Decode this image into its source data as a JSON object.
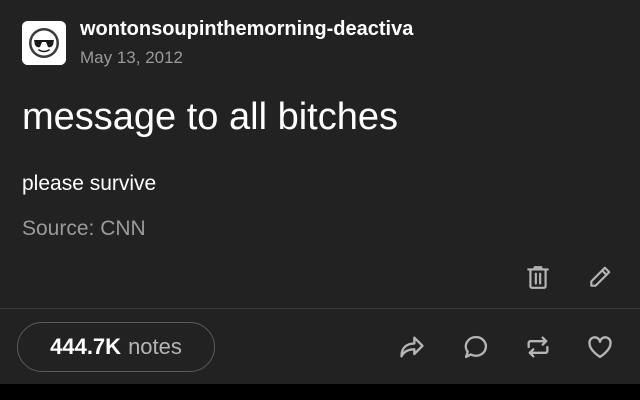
{
  "post": {
    "blog_name": "wontonsoupinthemorning-deactiva",
    "date": "May 13, 2012",
    "title": "message to all bitches",
    "body": "please survive",
    "source": "Source: CNN"
  },
  "footer": {
    "notes_count": "444.7K",
    "notes_label": "notes"
  },
  "icons": {
    "avatar": "sunglasses-face-avatar",
    "delete": "trash-icon",
    "edit": "pencil-icon",
    "share": "share-arrow-icon",
    "reply": "speech-bubble-icon",
    "reblog": "reblog-icon",
    "like": "heart-icon"
  },
  "colors": {
    "background": "#222222",
    "text": "#ffffff",
    "muted_text": "#9a9a9a",
    "pill_border": "#5a5a5a"
  }
}
